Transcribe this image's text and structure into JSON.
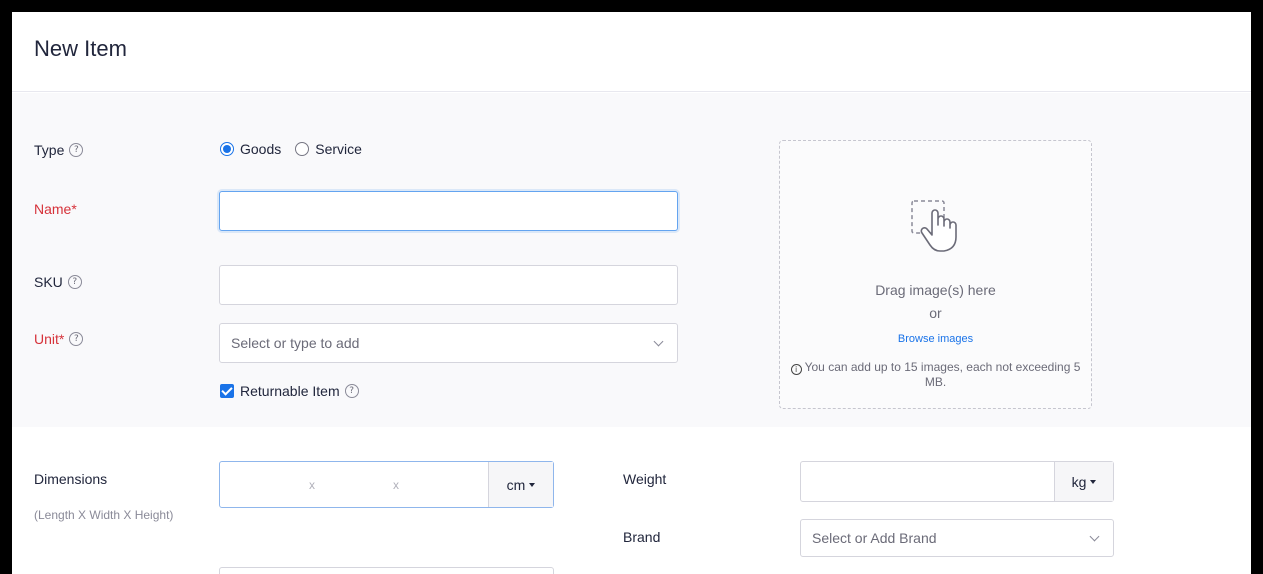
{
  "page": {
    "title": "New Item"
  },
  "form": {
    "type": {
      "label": "Type",
      "options": [
        {
          "label": "Goods",
          "checked": true
        },
        {
          "label": "Service",
          "checked": false
        }
      ]
    },
    "name": {
      "label": "Name*",
      "value": ""
    },
    "sku": {
      "label": "SKU",
      "value": ""
    },
    "unit": {
      "label": "Unit*",
      "placeholder": "Select or type to add"
    },
    "returnable": {
      "label": "Returnable Item",
      "checked": true
    },
    "dimensions": {
      "label": "Dimensions",
      "sub_label": "(Length X Width X Height)",
      "separator": "x",
      "unit": "cm"
    },
    "weight": {
      "label": "Weight",
      "unit": "kg",
      "value": ""
    },
    "brand": {
      "label": "Brand",
      "placeholder": "Select or Add Brand"
    }
  },
  "image_upload": {
    "drag_text": "Drag image(s) here",
    "or_text": "or",
    "browse_label": "Browse images",
    "note": "You can add up to 15 images, each not exceeding 5 MB."
  },
  "icons": {
    "help": "question-circle-icon",
    "info": "info-circle-icon",
    "drag": "drag-hand-icon",
    "chevron": "chevron-down-icon",
    "caret": "caret-down-icon"
  },
  "colors": {
    "accent": "#1a73e8",
    "required": "#d6323a",
    "section_bg": "#f9f9fb",
    "focus_border": "#64a4f0"
  }
}
